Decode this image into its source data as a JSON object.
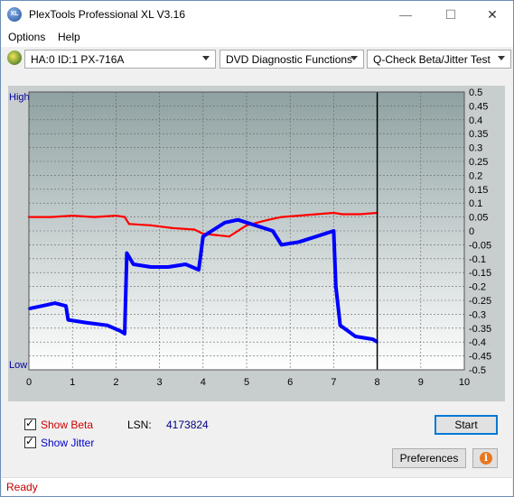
{
  "window": {
    "title": "PlexTools Professional XL V3.16"
  },
  "menu": {
    "options": "Options",
    "help": "Help"
  },
  "toolbar": {
    "drive": "HA:0 ID:1  PX-716A",
    "function": "DVD Diagnostic Functions",
    "test": "Q-Check Beta/Jitter Test"
  },
  "chart_data": {
    "type": "line",
    "left_axis": {
      "top_label": "High",
      "bottom_label": "Low"
    },
    "x_ticks": [
      "0",
      "1",
      "2",
      "3",
      "4",
      "5",
      "6",
      "7",
      "8",
      "9",
      "10"
    ],
    "xlim": [
      0,
      10
    ],
    "y_ticks": [
      "0.5",
      "0.45",
      "0.4",
      "0.35",
      "0.3",
      "0.25",
      "0.2",
      "0.15",
      "0.1",
      "0.05",
      "0",
      "-0.05",
      "-0.1",
      "-0.15",
      "-0.2",
      "-0.25",
      "-0.3",
      "-0.35",
      "-0.4",
      "-0.45",
      "-0.5"
    ],
    "ylim": [
      -0.5,
      0.5
    ],
    "end_marker_x": 8,
    "grid": true,
    "series": [
      {
        "name": "Beta",
        "color": "#ff0000",
        "x": [
          0,
          0.5,
          1.0,
          1.5,
          2.0,
          2.2,
          2.3,
          2.8,
          3.3,
          3.8,
          4.0,
          4.3,
          4.6,
          5.0,
          5.5,
          5.8,
          6.2,
          6.6,
          7.0,
          7.2,
          7.6,
          8.0
        ],
        "y": [
          0.05,
          0.05,
          0.055,
          0.05,
          0.055,
          0.05,
          0.025,
          0.02,
          0.01,
          0.005,
          -0.01,
          -0.015,
          -0.02,
          0.02,
          0.04,
          0.05,
          0.055,
          0.06,
          0.065,
          0.06,
          0.06,
          0.065
        ]
      },
      {
        "name": "Jitter",
        "color": "#0000ff",
        "x": [
          0,
          0.3,
          0.6,
          0.85,
          0.9,
          1.3,
          1.8,
          2.1,
          2.2,
          2.25,
          2.4,
          2.8,
          3.2,
          3.6,
          3.9,
          4.0,
          4.2,
          4.5,
          4.8,
          5.2,
          5.6,
          5.8,
          6.2,
          6.6,
          7.0,
          7.05,
          7.15,
          7.5,
          7.9,
          8.0
        ],
        "y": [
          -0.28,
          -0.27,
          -0.26,
          -0.27,
          -0.32,
          -0.33,
          -0.34,
          -0.36,
          -0.37,
          -0.08,
          -0.12,
          -0.13,
          -0.13,
          -0.12,
          -0.14,
          -0.02,
          0.0,
          0.03,
          0.04,
          0.02,
          0.0,
          -0.05,
          -0.04,
          -0.02,
          0.0,
          -0.2,
          -0.34,
          -0.38,
          -0.39,
          -0.4
        ]
      }
    ]
  },
  "options": {
    "show_beta": "Show Beta",
    "show_jitter": "Show Jitter",
    "beta_color": "#cc0000",
    "jitter_color": "#0000cc"
  },
  "lsn": {
    "label": "LSN:",
    "value": "4173824"
  },
  "buttons": {
    "start": "Start",
    "preferences": "Preferences"
  },
  "status": {
    "text": "Ready"
  }
}
